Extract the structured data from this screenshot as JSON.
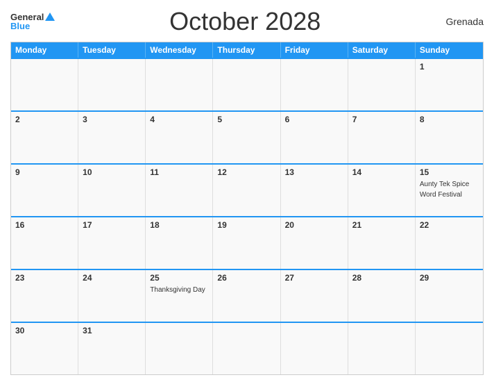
{
  "header": {
    "logo_general": "General",
    "logo_blue": "Blue",
    "title": "October 2028",
    "country": "Grenada"
  },
  "days_of_week": [
    {
      "label": "Monday"
    },
    {
      "label": "Tuesday"
    },
    {
      "label": "Wednesday"
    },
    {
      "label": "Thursday"
    },
    {
      "label": "Friday"
    },
    {
      "label": "Saturday"
    },
    {
      "label": "Sunday"
    }
  ],
  "weeks": [
    {
      "days": [
        {
          "number": "",
          "event": ""
        },
        {
          "number": "",
          "event": ""
        },
        {
          "number": "",
          "event": ""
        },
        {
          "number": "",
          "event": ""
        },
        {
          "number": "",
          "event": ""
        },
        {
          "number": "",
          "event": ""
        },
        {
          "number": "1",
          "event": ""
        }
      ]
    },
    {
      "days": [
        {
          "number": "2",
          "event": ""
        },
        {
          "number": "3",
          "event": ""
        },
        {
          "number": "4",
          "event": ""
        },
        {
          "number": "5",
          "event": ""
        },
        {
          "number": "6",
          "event": ""
        },
        {
          "number": "7",
          "event": ""
        },
        {
          "number": "8",
          "event": ""
        }
      ]
    },
    {
      "days": [
        {
          "number": "9",
          "event": ""
        },
        {
          "number": "10",
          "event": ""
        },
        {
          "number": "11",
          "event": ""
        },
        {
          "number": "12",
          "event": ""
        },
        {
          "number": "13",
          "event": ""
        },
        {
          "number": "14",
          "event": ""
        },
        {
          "number": "15",
          "event": "Aunty Tek Spice Word Festival"
        }
      ]
    },
    {
      "days": [
        {
          "number": "16",
          "event": ""
        },
        {
          "number": "17",
          "event": ""
        },
        {
          "number": "18",
          "event": ""
        },
        {
          "number": "19",
          "event": ""
        },
        {
          "number": "20",
          "event": ""
        },
        {
          "number": "21",
          "event": ""
        },
        {
          "number": "22",
          "event": ""
        }
      ]
    },
    {
      "days": [
        {
          "number": "23",
          "event": ""
        },
        {
          "number": "24",
          "event": ""
        },
        {
          "number": "25",
          "event": "Thanksgiving Day"
        },
        {
          "number": "26",
          "event": ""
        },
        {
          "number": "27",
          "event": ""
        },
        {
          "number": "28",
          "event": ""
        },
        {
          "number": "29",
          "event": ""
        }
      ]
    },
    {
      "days": [
        {
          "number": "30",
          "event": ""
        },
        {
          "number": "31",
          "event": ""
        },
        {
          "number": "",
          "event": ""
        },
        {
          "number": "",
          "event": ""
        },
        {
          "number": "",
          "event": ""
        },
        {
          "number": "",
          "event": ""
        },
        {
          "number": "",
          "event": ""
        }
      ]
    }
  ]
}
